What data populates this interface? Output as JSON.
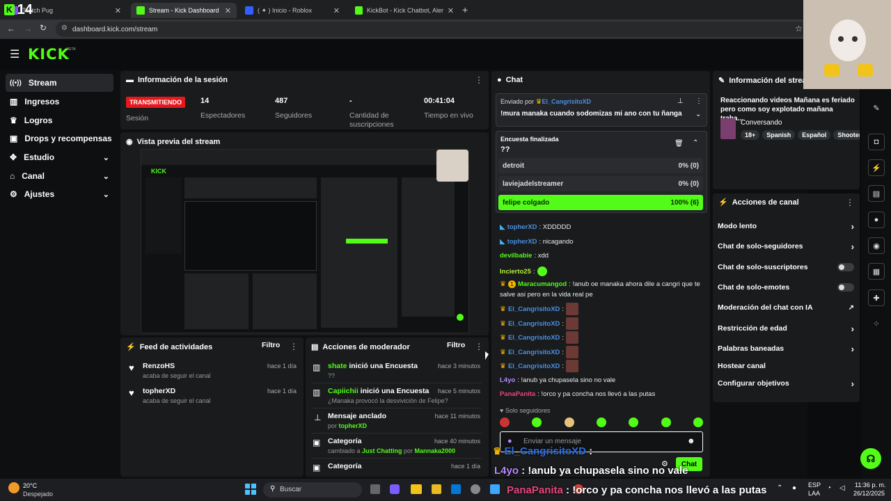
{
  "tabs": [
    {
      "label": "Twitch Pug",
      "color": "#9147ff"
    },
    {
      "label": "Stream - Kick Dashboard",
      "color": "#53fc18"
    },
    {
      "label": "( ✦ ) Inicio - Roblox",
      "color": "#335fff"
    },
    {
      "label": "KickBot - Kick Chatbot, Alerts, T",
      "color": "#53fc18"
    }
  ],
  "overlay_viewers": "14",
  "url": "dashboard.kick.com/stream",
  "logo": "KICK",
  "logo_beta": "BETA",
  "sidebar": [
    {
      "label": "Stream",
      "icon": "broadcast-icon"
    },
    {
      "label": "Ingresos",
      "icon": "chart-icon"
    },
    {
      "label": "Logros",
      "icon": "trophy-icon"
    },
    {
      "label": "Drops y recompensas",
      "icon": "gift-icon"
    },
    {
      "label": "Estudio",
      "icon": "studio-icon"
    },
    {
      "label": "Canal",
      "icon": "channel-icon"
    },
    {
      "label": "Ajustes",
      "icon": "gear-icon"
    }
  ],
  "session": {
    "title": "Información de la sesión",
    "status": "TRANSMITIENDO",
    "status_label": "Sesión",
    "viewers": "14",
    "viewers_label": "Espectadores",
    "followers": "487",
    "followers_label": "Seguidores",
    "subs": "-",
    "subs_label": "Cantidad de suscripciones",
    "time": "00:41:04",
    "time_label": "Tiempo en vivo"
  },
  "preview": {
    "title": "Vista previa del stream"
  },
  "activity": {
    "title": "Feed de actividades",
    "filter": "Filtro",
    "items": [
      {
        "name": "RenzoHS",
        "sub": "acaba de seguir el canal",
        "time": "hace 1 día"
      },
      {
        "name": "topherXD",
        "sub": "acaba de seguir el canal",
        "time": "hace 1 día"
      }
    ]
  },
  "modactions": {
    "title": "Acciones de moderador",
    "filter": "Filtro",
    "items": [
      {
        "user": "shate",
        "action": " inició una Encuesta",
        "sub": "??",
        "time": "hace 3 minutos"
      },
      {
        "user": "Capiichii",
        "action": " inició una Encuesta",
        "sub": "¿Manaka provocó la desvivición de Felipe?",
        "time": "hace 5 minutos"
      },
      {
        "user": "",
        "action": "Mensaje anclado",
        "sub_pre": "por ",
        "sub_user": "topherXD",
        "time": "hace 11 minutos"
      },
      {
        "user": "",
        "action": "Categoría",
        "sub_pre": "cambiado a ",
        "sub_user": "Just Chatting",
        "sub_mid": " por ",
        "sub_user2": "Mannaka2000",
        "time": "hace 40 minutos"
      },
      {
        "user": "",
        "action": "Categoría",
        "time": "hace 1 día"
      }
    ]
  },
  "chat": {
    "title": "Chat",
    "pinned_by": "Enviado por",
    "pinned_user": "El_CangrisitoXD",
    "pinned_msg": "!mura manaka cuando sodomizas mi ano con tu ñanga",
    "poll_title": "Encuesta finalizada",
    "poll_q": "??",
    "poll": [
      {
        "opt": "detroit",
        "pct": "0% (0)"
      },
      {
        "opt": "laviejadelstreamer",
        "pct": "0% (0)"
      },
      {
        "opt": "felipe colgado",
        "pct": "100% (6)"
      }
    ],
    "lines": [
      {
        "user": "topherXD",
        "msg": ": XDDDDD"
      },
      {
        "user": "topherXD",
        "msg": ": nicagando"
      },
      {
        "user": "devilbabie",
        "msg": ": xdd"
      },
      {
        "user": "Incierto25",
        "msg": ":"
      },
      {
        "user": "Maracumangod",
        "msg": ": !anub oe manaka ahora dile a cangri que te"
      },
      {
        "user": "",
        "msg": "salve asi pero en la vida real pe"
      },
      {
        "user": "El_CangrisitoXD",
        "msg": ":"
      },
      {
        "user": "El_CangrisitoXD",
        "msg": ":"
      },
      {
        "user": "El_CangrisitoXD",
        "msg": ":"
      },
      {
        "user": "El_CangrisitoXD",
        "msg": ":"
      },
      {
        "user": "El_CangrisitoXD",
        "msg": ":"
      },
      {
        "user": "L4yo",
        "msg": ": !anub ya chupasela sino no vale"
      },
      {
        "user": "PanaPanita",
        "msg": ": !orco y pa concha nos llevó a las putas"
      }
    ],
    "followers_only": "Solo seguidores",
    "input_placeholder": "Enviar un mensaje",
    "send": "Chat",
    "big1_user": "El_CangrisitoXD",
    "big1_sep": " :",
    "big2_user": "L4yo",
    "big2_msg": " : !anub ya chupasela sino no vale",
    "big3_user": "PanaPanita",
    "big3_msg": " : !orco y pa concha nos llevó a las putas"
  },
  "streaminfo": {
    "title": "Información del stream",
    "desc": "Reaccionando videos Mañana es feriado pero como soy explotado mañana traba...",
    "category": "Conversando",
    "tags": [
      "18+",
      "Spanish",
      "Español",
      "Shooter"
    ]
  },
  "channel_actions": {
    "title": "Acciones de canal",
    "items": [
      {
        "label": "Modo lento",
        "kind": "arrow"
      },
      {
        "label": "Chat de solo-seguidores",
        "kind": "arrow"
      },
      {
        "label": "Chat de solo-suscriptores",
        "kind": "toggle"
      },
      {
        "label": "Chat de solo-emotes",
        "kind": "toggle"
      },
      {
        "label": "Moderación del chat con IA",
        "kind": "ext"
      },
      {
        "label": "Restricción de edad",
        "kind": "arrow"
      },
      {
        "label": "Palabras baneadas",
        "kind": "arrow"
      },
      {
        "label": "Hostear canal",
        "kind": "none"
      },
      {
        "label": "Configurar objetivos",
        "kind": "arrow"
      }
    ]
  },
  "taskbar": {
    "temp": "20°C",
    "weather": "Despejado",
    "search": "Buscar",
    "lang1": "ESP",
    "lang2": "LAA",
    "time": "11:36 p. m.",
    "date": "26/12/2025"
  }
}
